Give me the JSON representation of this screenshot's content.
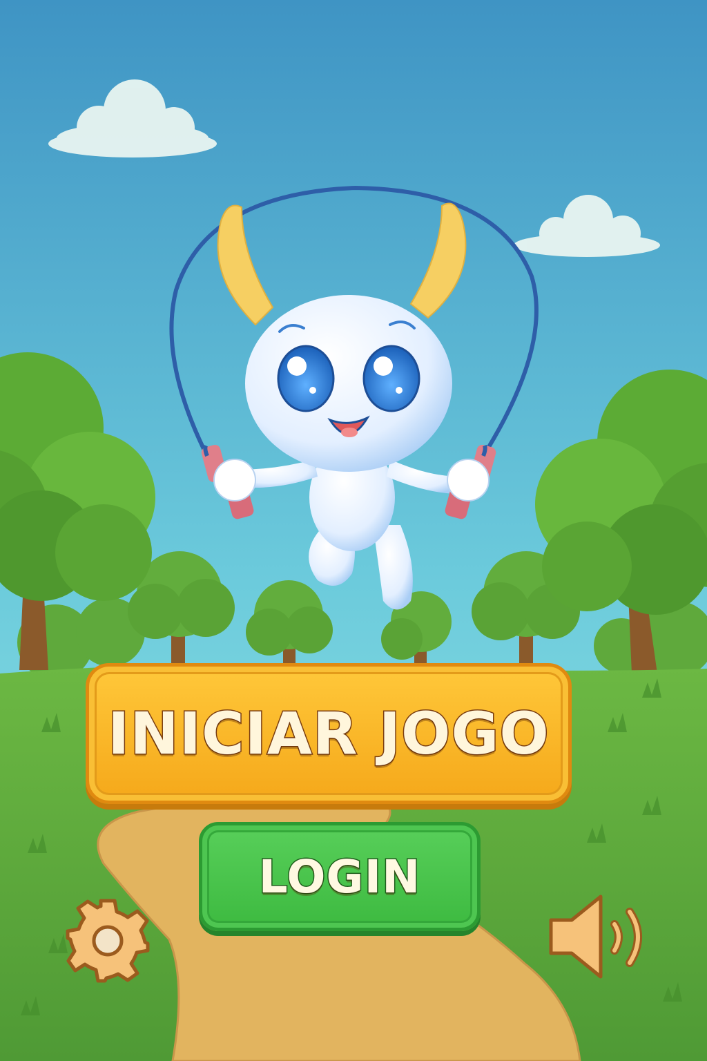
{
  "menu": {
    "start_label": "INICIAR JOGO",
    "login_label": "LOGIN"
  },
  "icons": {
    "settings": "gear-icon",
    "sound": "speaker-volume-icon",
    "mascot": "white-bunny-jump-rope-mascot"
  },
  "colors": {
    "start_button": "#f7b325",
    "login_button": "#45c049",
    "sky_top": "#3f94c4",
    "sky_bottom": "#8ee3e3",
    "grass": "#5aa83a",
    "path": "#e2b45f"
  }
}
